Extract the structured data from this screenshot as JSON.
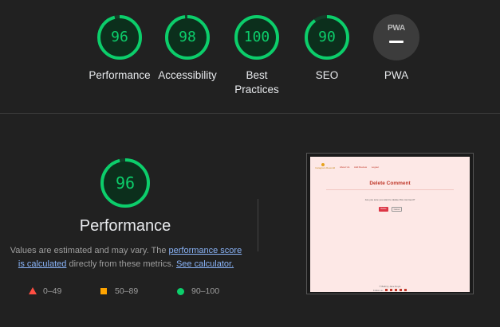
{
  "categories": [
    {
      "score": "96",
      "label": "Performance",
      "value": 96,
      "color": "#0cce6b"
    },
    {
      "score": "98",
      "label": "Accessibility",
      "value": 98,
      "color": "#0cce6b"
    },
    {
      "score": "100",
      "label": "Best\nPractices",
      "value": 100,
      "color": "#0cce6b"
    },
    {
      "score": "90",
      "label": "SEO",
      "value": 90,
      "color": "#0cce6b"
    },
    {
      "badge_text": "PWA",
      "label": "PWA"
    }
  ],
  "performance": {
    "score": "96",
    "value": 96,
    "title": "Performance",
    "desc_prefix": "Values are estimated and may vary. The ",
    "link1": "performance score is calculated",
    "desc_middle": " directly from these metrics. ",
    "link2": "See calculator."
  },
  "legend": [
    {
      "range": "0–49",
      "icon": "red-triangle-icon",
      "color": "#ff4e42"
    },
    {
      "range": "50–89",
      "icon": "orange-square-icon",
      "color": "#ffa400"
    },
    {
      "range": "90–100",
      "icon": "green-circle-icon",
      "color": "#0cce6b"
    }
  ],
  "screenshot": {
    "logo_text": "Instagram Reworld",
    "nav_links": [
      "About Us",
      "Add Review",
      "Logout"
    ],
    "heading": "Delete Comment",
    "question": "Are you sure you want to delete this comment?",
    "delete_label": "Delete",
    "cancel_label": "Cancel",
    "footer_copyright": "© Built by Jane Doyle",
    "footer_follow": "Follow us:"
  },
  "colors": {
    "background": "#212121",
    "good": "#0cce6b",
    "link": "#8ab4f8"
  }
}
